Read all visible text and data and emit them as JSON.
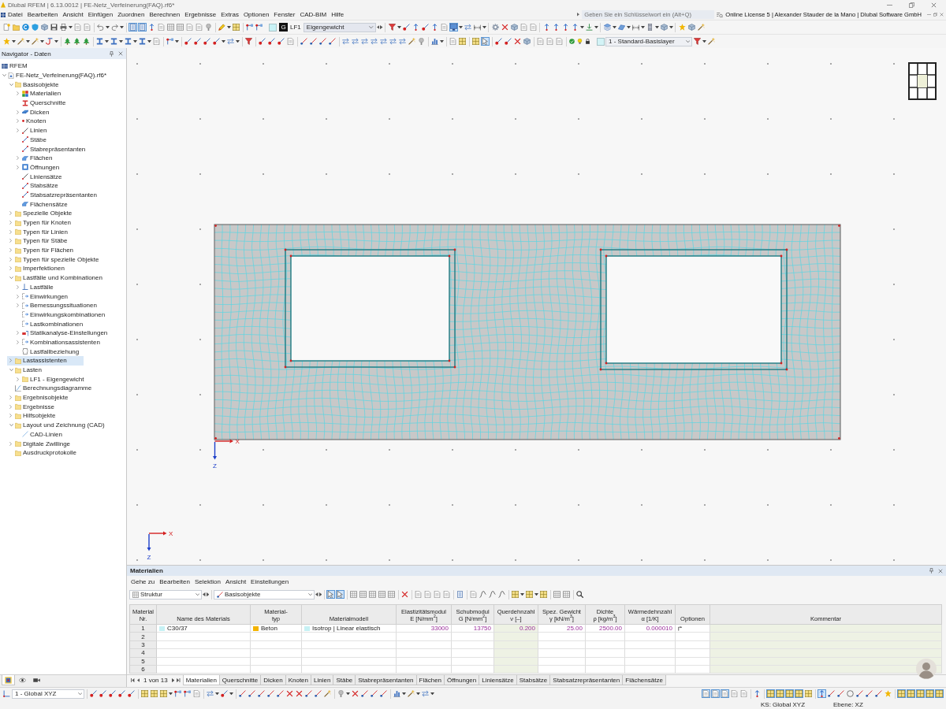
{
  "window": {
    "title": "Dlubal RFEM | 6.13.0012 | FE-Netz_Verfeinerung(FAQ).rf6*"
  },
  "menu": [
    "Datei",
    "Bearbeiten",
    "Ansicht",
    "Einfügen",
    "Zuordnen",
    "Berechnen",
    "Ergebnisse",
    "Extras",
    "Optionen",
    "Fenster",
    "CAD-BIM",
    "Hilfe"
  ],
  "search": {
    "placeholder": "Geben Sie ein Schlüsselwort ein (Alt+Q)"
  },
  "license": "Online License 5 | Alexander Stauder de la Mano | Dlubal Software GmbH",
  "toolbars": {
    "main": {
      "pressed": [
        false,
        false,
        false,
        false,
        false,
        false,
        false,
        false,
        false,
        false,
        false,
        true,
        true,
        false,
        false,
        false,
        false,
        false,
        false,
        false,
        false,
        false,
        false,
        false,
        false,
        false,
        false,
        false,
        false,
        false,
        true,
        false,
        false,
        false,
        false,
        false,
        false,
        false,
        false,
        false,
        false,
        false,
        false,
        false,
        false,
        false,
        false,
        false,
        false,
        false,
        false
      ]
    },
    "objects": {
      "pressed": [
        false,
        false,
        false,
        false,
        false,
        false,
        false,
        false,
        false,
        false,
        false,
        false,
        false,
        false,
        false,
        false,
        false,
        false,
        false,
        false,
        false,
        false,
        false,
        false,
        false,
        false,
        false,
        false,
        false,
        false,
        false,
        false,
        false,
        false,
        false,
        false,
        false,
        false,
        false,
        false,
        true,
        false,
        false,
        false,
        false,
        false,
        false,
        false,
        false,
        false
      ]
    },
    "table": {
      "pressed": [
        true,
        true,
        false,
        false,
        false,
        false,
        false,
        false,
        false,
        false,
        false,
        false,
        false,
        false,
        false,
        false,
        false,
        false,
        false,
        false,
        false,
        false,
        false
      ]
    },
    "status_left": {
      "pressed": [
        false,
        false,
        false,
        false,
        false,
        false,
        false,
        false,
        false,
        false,
        false,
        false,
        false,
        false,
        false,
        false,
        false,
        false,
        false,
        false,
        false,
        false,
        false,
        false,
        false,
        false,
        false,
        false,
        false,
        false,
        false,
        false
      ]
    },
    "status_right": {
      "pressed": [
        true,
        true,
        true,
        false,
        false,
        false,
        true,
        true,
        true,
        true,
        false,
        true,
        false,
        false,
        false,
        false,
        false,
        false,
        false,
        true,
        true,
        true,
        true,
        true
      ]
    }
  },
  "load_case": {
    "category": "G",
    "number": "LF1",
    "name": "Eigengewicht"
  },
  "layer": {
    "name": "1 - Standard-Basislayer"
  },
  "navigator": {
    "title": "Navigator - Daten",
    "tabs": [
      {
        "selected": true
      },
      {
        "selected": false
      },
      {
        "selected": false
      }
    ],
    "tree": [
      {
        "label": "RFEM",
        "kind": "root",
        "selected": false
      },
      {
        "label": "FE-Netz_Verfeinerung(FAQ).rf6*",
        "kind": "model",
        "selected": false,
        "expanded": true,
        "children": [
          {
            "label": "Basisobjekte",
            "kind": "folder",
            "selected": false,
            "expanded": true,
            "children": [
              {
                "label": "Materialien",
                "kind": "object",
                "selected": false,
                "expanded": false
              },
              {
                "label": "Querschnitte",
                "kind": "object",
                "selected": false
              },
              {
                "label": "Dicken",
                "kind": "object",
                "selected": false,
                "expanded": false
              },
              {
                "label": "Knoten",
                "kind": "object",
                "selected": false,
                "expanded": false
              },
              {
                "label": "Linien",
                "kind": "object",
                "selected": false,
                "expanded": false
              },
              {
                "label": "Stäbe",
                "kind": "object",
                "selected": false
              },
              {
                "label": "Stabrepräsentanten",
                "kind": "object",
                "selected": false
              },
              {
                "label": "Flächen",
                "kind": "object",
                "selected": false,
                "expanded": false
              },
              {
                "label": "Öffnungen",
                "kind": "object",
                "selected": false,
                "expanded": false
              },
              {
                "label": "Liniensätze",
                "kind": "object",
                "selected": false
              },
              {
                "label": "Stabsätze",
                "kind": "object",
                "selected": false
              },
              {
                "label": "Stabsatzrepräsentanten",
                "kind": "object",
                "selected": false
              },
              {
                "label": "Flächensätze",
                "kind": "object",
                "selected": false
              }
            ]
          },
          {
            "label": "Spezielle Objekte",
            "kind": "folder",
            "selected": false,
            "expanded": false
          },
          {
            "label": "Typen für Knoten",
            "kind": "folder",
            "selected": false,
            "expanded": false
          },
          {
            "label": "Typen für Linien",
            "kind": "folder",
            "selected": false,
            "expanded": false
          },
          {
            "label": "Typen für Stäbe",
            "kind": "folder",
            "selected": false,
            "expanded": false
          },
          {
            "label": "Typen für Flächen",
            "kind": "folder",
            "selected": false,
            "expanded": false
          },
          {
            "label": "Typen für spezielle Objekte",
            "kind": "folder",
            "selected": false,
            "expanded": false
          },
          {
            "label": "Imperfektionen",
            "kind": "folder",
            "selected": false,
            "expanded": false
          },
          {
            "label": "Lastfälle und Kombinationen",
            "kind": "folder",
            "selected": false,
            "expanded": true,
            "children": [
              {
                "label": "Lastfälle",
                "kind": "object",
                "selected": false,
                "expanded": false
              },
              {
                "label": "Einwirkungen",
                "kind": "object",
                "selected": false,
                "expanded": false
              },
              {
                "label": "Bemessungssituationen",
                "kind": "object",
                "selected": false,
                "expanded": false
              },
              {
                "label": "Einwirkungskombinationen",
                "kind": "object",
                "selected": false
              },
              {
                "label": "Lastkombinationen",
                "kind": "object",
                "selected": false
              },
              {
                "label": "Statikanalyse-Einstellungen",
                "kind": "object",
                "selected": false,
                "expanded": false
              },
              {
                "label": "Kombinationsassistenten",
                "kind": "object",
                "selected": false,
                "expanded": false
              },
              {
                "label": "Lastfallbeziehung",
                "kind": "object",
                "selected": false
              }
            ]
          },
          {
            "label": "Lastassistenten",
            "kind": "folder",
            "selected": true,
            "expanded": false
          },
          {
            "label": "Lasten",
            "kind": "folder",
            "selected": false,
            "expanded": true,
            "children": [
              {
                "label": "LF1 - Eigengewicht",
                "kind": "folder",
                "selected": false,
                "expanded": false
              }
            ]
          },
          {
            "label": "Berechnungsdiagramme",
            "kind": "object",
            "selected": false
          },
          {
            "label": "Ergebnisobjekte",
            "kind": "folder",
            "selected": false,
            "expanded": false
          },
          {
            "label": "Ergebnisse",
            "kind": "folder",
            "selected": false,
            "expanded": false
          },
          {
            "label": "Hilfsobjekte",
            "kind": "folder",
            "selected": false,
            "expanded": false
          },
          {
            "label": "Layout und Zeichnung (CAD)",
            "kind": "folder",
            "selected": false,
            "expanded": true,
            "children": [
              {
                "label": "CAD-Linien",
                "kind": "object",
                "selected": false
              }
            ]
          },
          {
            "label": "Digitale Zwillinge",
            "kind": "folder",
            "selected": false,
            "expanded": false
          },
          {
            "label": "Ausdruckprotokolle",
            "kind": "folder",
            "selected": false
          }
        ]
      }
    ]
  },
  "viewport": {
    "model_axes": {
      "x": "X",
      "z": "Z"
    },
    "view_axes": {
      "x": "X",
      "z": "Z"
    }
  },
  "table_panel": {
    "title": "Materialien",
    "menu": [
      "Gehe zu",
      "Bearbeiten",
      "Selektion",
      "Ansicht",
      "Einstellungen"
    ],
    "view_select": "Struktur",
    "object_select": "Basisobjekte",
    "columns": [
      {
        "lines": [
          "Material",
          "Nr."
        ]
      },
      {
        "lines": [
          "Name des Materials"
        ]
      },
      {
        "lines": [
          "Material-",
          "typ"
        ]
      },
      {
        "lines": [
          "Materialmodell"
        ]
      },
      {
        "lines": [
          "Elastizitätsmodul",
          "E [N/mm$^{2}$]"
        ]
      },
      {
        "lines": [
          "Schubmodul",
          "G [N/mm$^{2}$]"
        ]
      },
      {
        "lines": [
          "Querdehnzahl",
          "ν [–]"
        ]
      },
      {
        "lines": [
          "Spez. Gewicht",
          "γ [kN/m$^{3}$]"
        ]
      },
      {
        "lines": [
          "Dichte",
          "ρ [kg/m$^{3}$]"
        ]
      },
      {
        "lines": [
          "Wärmedehnzahl",
          "α [1/K]"
        ]
      },
      {
        "lines": [
          "Optionen"
        ]
      },
      {
        "lines": [
          "Kommentar"
        ]
      }
    ],
    "rows": [
      {
        "no": "1",
        "name": {
          "text": "C30/37",
          "color": "#c6f1f4"
        },
        "type": {
          "text": "Beton",
          "color": "#f4b400"
        },
        "model": {
          "text": "Isotrop | Linear elastisch",
          "color": "#c6f1f4"
        },
        "e": "33000",
        "g": "13750",
        "nu": "0.200",
        "gamma": "25.00",
        "rho": "2500.00",
        "alpha": "0.000010",
        "has_options": true
      },
      {
        "no": "2"
      },
      {
        "no": "3"
      },
      {
        "no": "4"
      },
      {
        "no": "5"
      },
      {
        "no": "6"
      }
    ],
    "pager": "1 von 13",
    "tabs": [
      {
        "label": "Materialien",
        "selected": true
      },
      {
        "label": "Querschnitte",
        "selected": false
      },
      {
        "label": "Dicken",
        "selected": false
      },
      {
        "label": "Knoten",
        "selected": false
      },
      {
        "label": "Linien",
        "selected": false
      },
      {
        "label": "Stäbe",
        "selected": false
      },
      {
        "label": "Stabrepräsentanten",
        "selected": false
      },
      {
        "label": "Flächen",
        "selected": false
      },
      {
        "label": "Öffnungen",
        "selected": false
      },
      {
        "label": "Liniensätze",
        "selected": false
      },
      {
        "label": "Stabsätze",
        "selected": false
      },
      {
        "label": "Stabsatzrepräsentanten",
        "selected": false
      },
      {
        "label": "Flächensätze",
        "selected": false
      }
    ]
  },
  "coordinate_system": "1 - Global XYZ",
  "status_bar": [
    "KS: Global XYZ",
    "Ebene: XZ"
  ]
}
